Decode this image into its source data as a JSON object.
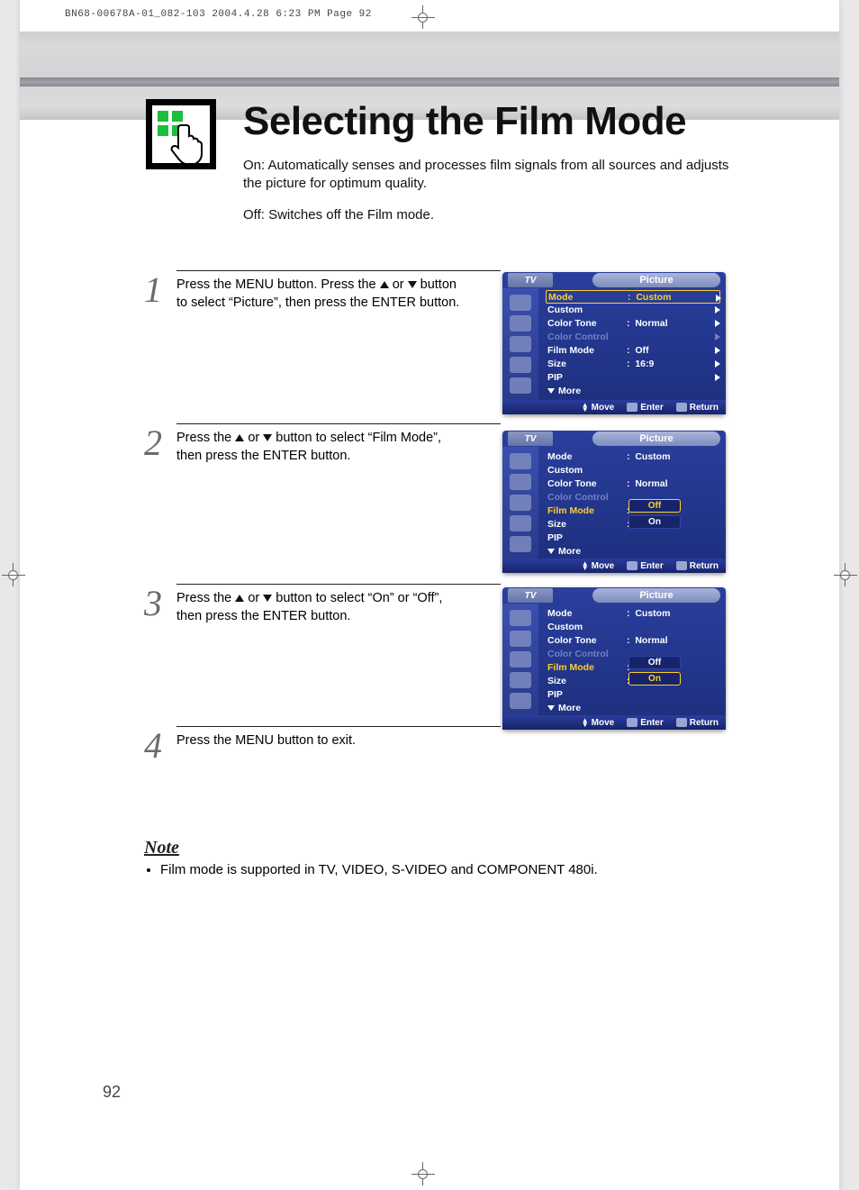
{
  "crop_header": "BN68-00678A-01_082-103  2004.4.28  6:23 PM  Page 92",
  "page_number": "92",
  "title": "Selecting the Film Mode",
  "intro": {
    "p1": "On: Automatically senses and processes film signals from all sources and adjusts the picture for optimum quality.",
    "p2": "Off: Switches off the Film mode."
  },
  "steps": {
    "s1a": "Press the MENU button. Press the ",
    "s1b": " or ",
    "s1c": " button to select “Picture”, then press the ENTER button.",
    "s2a": "Press the ",
    "s2b": " or ",
    "s2c": " button to select “Film Mode”, then press the ENTER button.",
    "s3a": "Press the ",
    "s3b": " or ",
    "s3c": " button to select “On” or “Off”, then press the ENTER button.",
    "s4": "Press the MENU button to exit."
  },
  "note": {
    "title": "Note",
    "item1": "Film mode is supported in TV, VIDEO, S-VIDEO and COMPONENT 480i."
  },
  "osd": {
    "tv": "TV",
    "menu_title": "Picture",
    "labels": {
      "mode": "Mode",
      "custom": "Custom",
      "color_tone": "Color Tone",
      "color_control": "Color Control",
      "film_mode": "Film Mode",
      "size": "Size",
      "pip": "PIP",
      "more": "More"
    },
    "values": {
      "mode": "Custom",
      "color_tone": "Normal",
      "film_mode": "Off",
      "size": "16:9"
    },
    "options": {
      "off": "Off",
      "on": "On"
    },
    "foot": {
      "move": "Move",
      "enter": "Enter",
      "return": "Return"
    }
  }
}
